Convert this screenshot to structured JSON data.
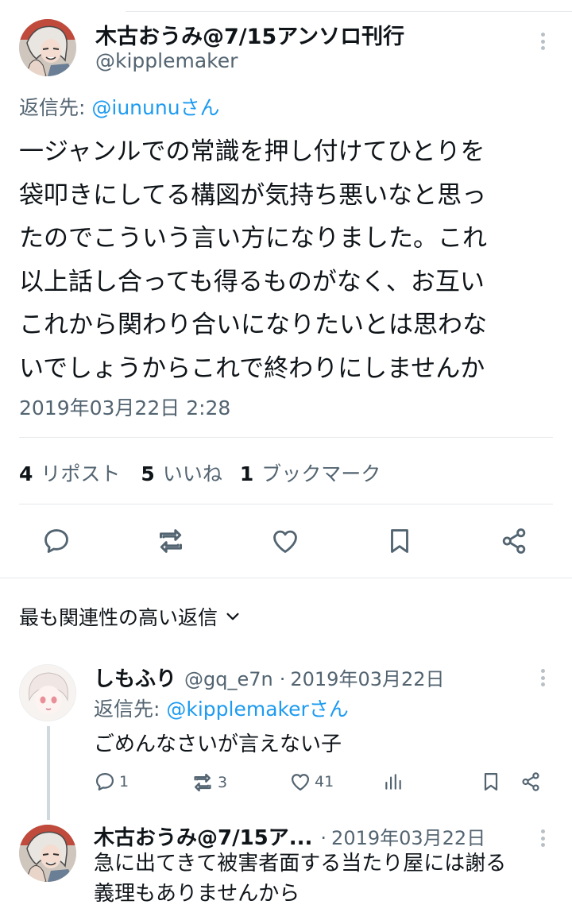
{
  "tweet": {
    "author_name": "木古おうみ@7/15アンソロ刊行",
    "author_handle": "@kipplemaker",
    "reply_prefix": "返信先: ",
    "reply_to": "@iununuさん",
    "body_lines": [
      "一ジャンルでの常識を押し付けてひとりを",
      "袋叩きにしてる構図が気持ち悪いなと思っ",
      "たのでこういう言い方になりました。これ",
      "以上話し合っても得るものがなく、お互い",
      "これから関わり合いになりたいとは思わな",
      "いでしょうからこれで終わりにしませんか"
    ],
    "timestamp": "2019年03月22日 2:28",
    "stats": {
      "reposts_count": "4",
      "reposts_label": "リポスト",
      "likes_count": "5",
      "likes_label": "いいね",
      "bookmarks_count": "1",
      "bookmarks_label": "ブックマーク"
    },
    "actions": [
      "reply-icon",
      "retweet-icon",
      "like-icon",
      "bookmark-icon",
      "share-icon"
    ]
  },
  "replies_header": {
    "label": "最も関連性の高い返信"
  },
  "replies": [
    {
      "author_name": "しもふり",
      "author_handle": "@gq_e7n",
      "separator": "·",
      "date": "2019年03月22日",
      "reply_prefix": "返信先: ",
      "reply_to": "@kipplemakerさん",
      "text": "ごめんなさいが言えない子",
      "reply_count": "1",
      "retweet_count": "3",
      "like_count": "41"
    },
    {
      "author_name": "木古おうみ@7/15ア...",
      "separator": "·",
      "date": "2019年03月22日",
      "text_lines": [
        "急に出てきて被害者面する当たり屋には謝る",
        "義理もありませんから"
      ]
    }
  ],
  "colors": {
    "text": "#0f1419",
    "muted": "#536471",
    "link": "#1d9bf0",
    "divider": "#e6e9ec",
    "thread_line": "#cfd9de"
  }
}
